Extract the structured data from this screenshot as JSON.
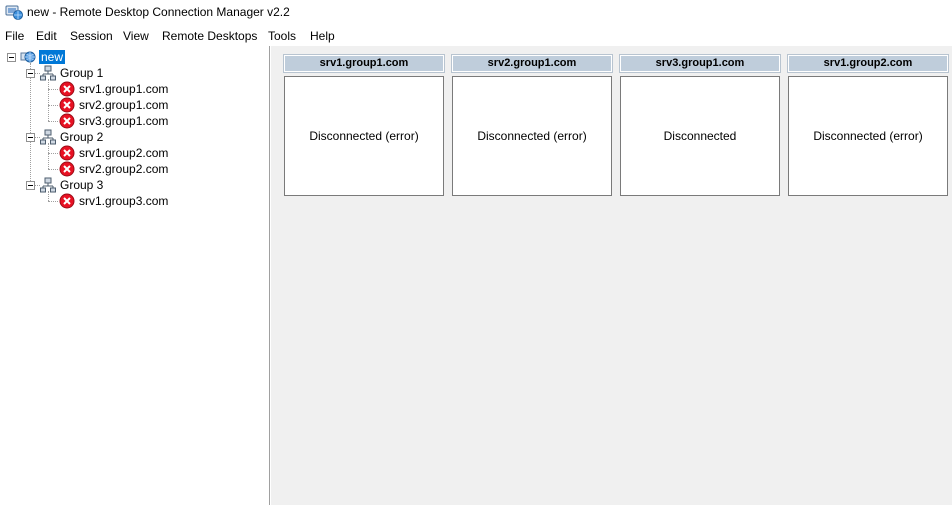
{
  "window": {
    "title": "new - Remote Desktop Connection Manager v2.2",
    "icon": "rdcman-app-icon"
  },
  "menu": [
    "File",
    "Edit",
    "Session",
    "View",
    "Remote Desktops",
    "Tools",
    "Help"
  ],
  "tree": {
    "root": {
      "label": "new",
      "icon": "globe-network-icon",
      "selected": true
    },
    "groups": [
      {
        "label": "Group 1",
        "icon": "network-group-icon",
        "servers": [
          "srv1.group1.com",
          "srv2.group1.com",
          "srv3.group1.com"
        ]
      },
      {
        "label": "Group 2",
        "icon": "network-group-icon",
        "servers": [
          "srv1.group2.com",
          "srv2.group2.com"
        ]
      },
      {
        "label": "Group 3",
        "icon": "network-group-icon",
        "servers": [
          "srv1.group3.com"
        ]
      }
    ],
    "server_icon": "error-x-icon"
  },
  "thumbnails": [
    {
      "server": "srv1.group1.com",
      "status": "Disconnected (error)"
    },
    {
      "server": "srv2.group1.com",
      "status": "Disconnected (error)"
    },
    {
      "server": "srv3.group1.com",
      "status": "Disconnected"
    },
    {
      "server": "srv1.group2.com",
      "status": "Disconnected (error)"
    }
  ],
  "colors": {
    "selection": "#0078d7",
    "thumb_header": "#bfcddb",
    "content_bg": "#f0f0f0",
    "error_red": "#e81123"
  }
}
